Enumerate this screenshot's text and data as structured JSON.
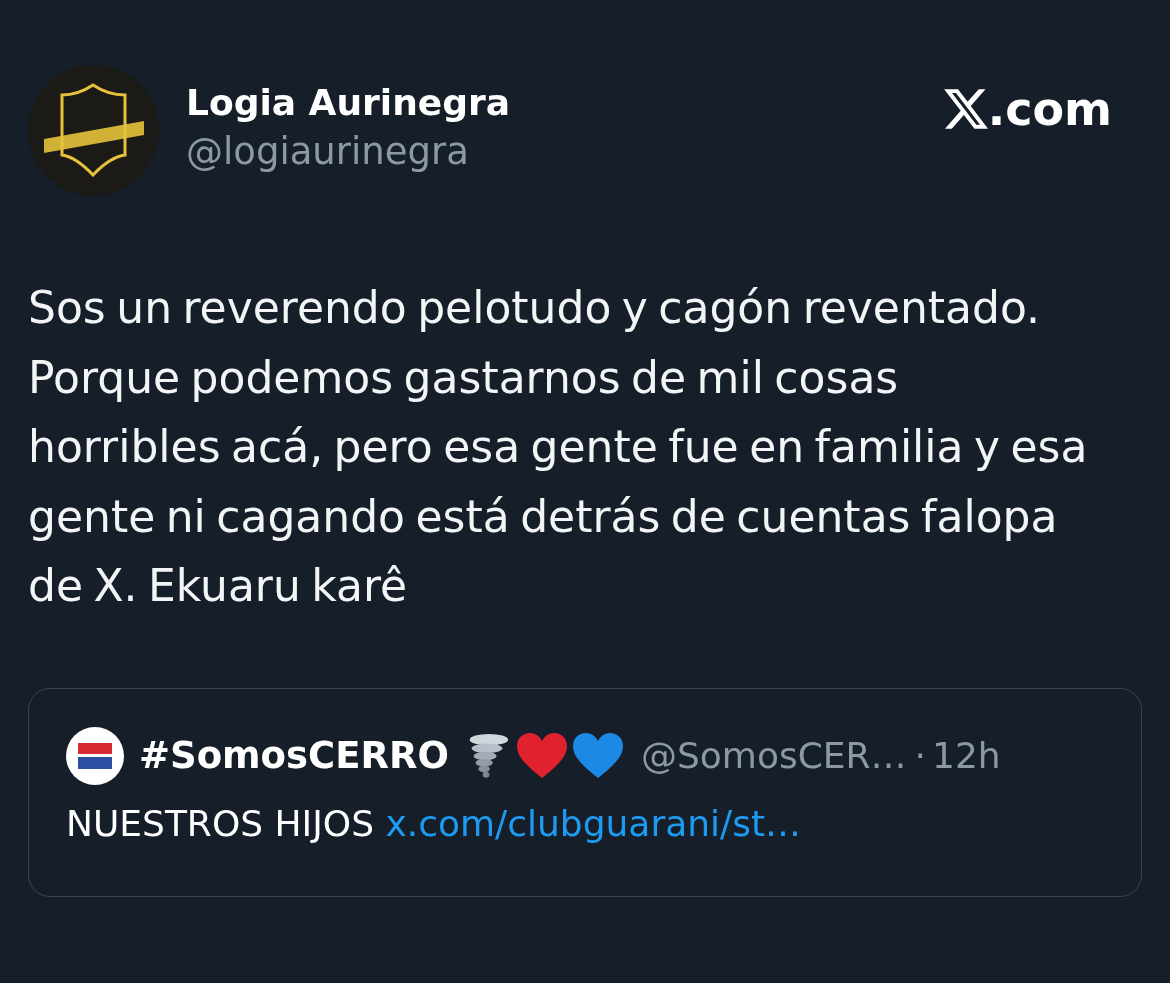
{
  "post": {
    "author": {
      "name": "Logia Aurinegra",
      "handle": "@logiaurinegra"
    },
    "brand": {
      "suffix": ".com"
    },
    "text": "Sos un reverendo pelotudo y cagón reventado. Porque podemos gastarnos de mil cosas horribles acá, pero esa gente fue en familia y esa gente ni cagando está detrás de cuentas falopa de X. Ekuaru karê",
    "quote": {
      "author": {
        "name": "#SomosCERRO",
        "emojis": [
          {
            "kind": "tornado"
          },
          {
            "kind": "heart",
            "color": "#e0212e"
          },
          {
            "kind": "heart",
            "color": "#1e88e5"
          }
        ],
        "handle": "@SomosCER…",
        "separator": "·",
        "time": "12h"
      },
      "text": "NUESTROS HIJOS",
      "link": "x.com/clubguarani/st…"
    }
  }
}
